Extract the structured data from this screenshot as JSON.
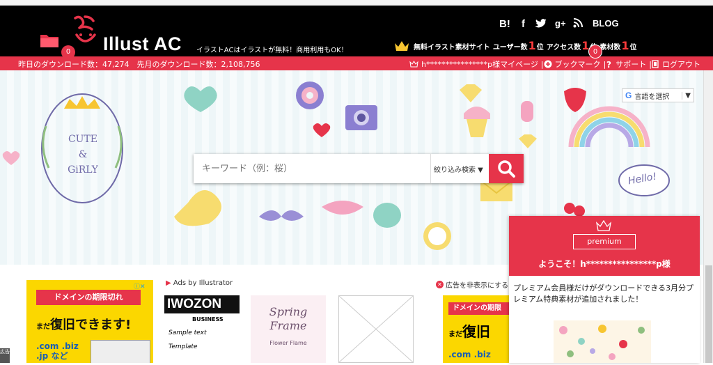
{
  "header": {
    "logo_text": "Illust AC",
    "tagline": "イラストACはイラストが無料！商用利用もOK！",
    "folder_badge": "0",
    "social": {
      "hatena": "B!",
      "facebook": "f",
      "google_plus": "g+",
      "blog": "BLOG"
    },
    "ranking": {
      "prefix": "無料イラスト素材サイト",
      "users_label": "ユーザー数",
      "users_rank": "1",
      "access_label": "アクセス数",
      "access_rank": "1",
      "materials_label": "素材数",
      "materials_rank": "1",
      "rank_suffix": "位"
    },
    "notification_badge": "0"
  },
  "subbar": {
    "downloads_yesterday": "昨日のダウンロード数：47,274　先月のダウンロード数：2,108,756",
    "mypage": "h****************p様マイページ",
    "separator": "|",
    "bookmark": "ブックマーク",
    "support": "サポート",
    "logout": "ログアウト"
  },
  "hero": {
    "badge_text_1": "CUTE",
    "badge_text_2": "&",
    "badge_text_3": "GiRLY",
    "hello": "Hello!"
  },
  "search": {
    "placeholder": "キーワード（例：桜）",
    "filter_label": "絞り込み検索 ▼"
  },
  "language": {
    "label": "言語を選択",
    "g": "G",
    "dropdown": "▼"
  },
  "content": {
    "ads_by": "Ads by Illustrator",
    "hide_ad": "広告を非表示にする",
    "ad1": {
      "title": "ドメインの期限切れ",
      "line2_small": "まだ",
      "line2": "復旧できます!",
      "line3a": ".com .biz",
      "line3b": ".jp など",
      "ad_choice": "ⓘ✕"
    },
    "thumb1_title": "IWOZON",
    "thumb1_sub": "BUSINESS",
    "thumb1_sample1": "Sample text",
    "thumb1_sample2": "Template",
    "thumb2_title1": "Spring",
    "thumb2_title2": "Frame",
    "thumb2_sub": "Flower Flame",
    "ad2": {
      "title": "ドメインの期限",
      "line2_small": "まだ",
      "line2": "復旧",
      "line3": ".com .biz"
    },
    "left_ad_label": "広告"
  },
  "popup": {
    "ribbon": "premium",
    "welcome": "ようこそ！h****************p様",
    "body": "プレミアム会員様だけがダウンロードできる3月分プレミアム特典素材が追加されました！"
  },
  "colors": {
    "brand_red": "#e6344a",
    "header_bg": "#000000",
    "ad_yellow": "#fbd700"
  }
}
